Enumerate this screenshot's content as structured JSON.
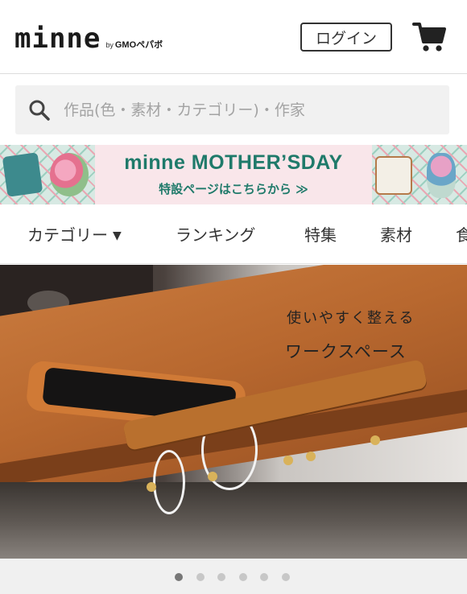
{
  "header": {
    "logo_text": "minne",
    "logo_by": "by",
    "logo_company": "GMOペパボ",
    "login_label": "ログイン",
    "cart_icon": "cart-icon"
  },
  "search": {
    "placeholder": "作品(色・素材・カテゴリー)・作家",
    "icon": "search-icon"
  },
  "banner": {
    "title": "minne MOTHER’SDAY",
    "subtitle": "特設ページはこちらから ≫"
  },
  "nav": {
    "items": [
      {
        "label": "カテゴリー",
        "has_caret": true
      },
      {
        "label": "ランキング"
      },
      {
        "label": "特集"
      },
      {
        "label": "素材"
      },
      {
        "label": "食"
      }
    ],
    "caret": "▼"
  },
  "hero": {
    "line1": "使いやすく整える",
    "line2": "ワークスペース"
  },
  "carousel": {
    "total": 6,
    "active_index": 0
  },
  "colors": {
    "brand_green": "#1f7a6a",
    "banner_pink": "#f9e6ea",
    "search_bg": "#f1f1f1"
  }
}
